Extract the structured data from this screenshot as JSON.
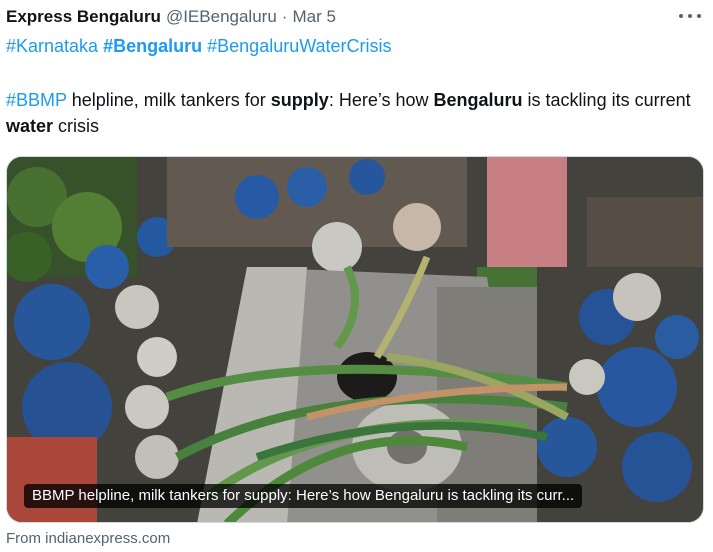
{
  "tweet": {
    "author_name": "Express Bengaluru",
    "handle": "@IEBengaluru",
    "separator": "·",
    "date": "Mar 5",
    "hashtags": [
      "#Karnataka",
      "#Bengaluru",
      "#BengaluruWaterCrisis"
    ],
    "body": {
      "tag": "#BBMP",
      "t1": " helpline, milk tankers for ",
      "b1": "supply",
      "t2": ": Here’s how ",
      "b2": "Bengaluru",
      "t3": " is tackling its current ",
      "b3": "water",
      "t4": " crisis"
    },
    "card": {
      "caption": "BBMP helpline, milk tankers for supply: Here’s how Bengaluru is tackling its curr...",
      "source": "From indianexpress.com"
    }
  },
  "colors": {
    "link": "#1d9bf0",
    "secondary_text": "#536471",
    "primary_text": "#0f1419"
  },
  "icons": {
    "more": "more-horizontal-icon"
  }
}
